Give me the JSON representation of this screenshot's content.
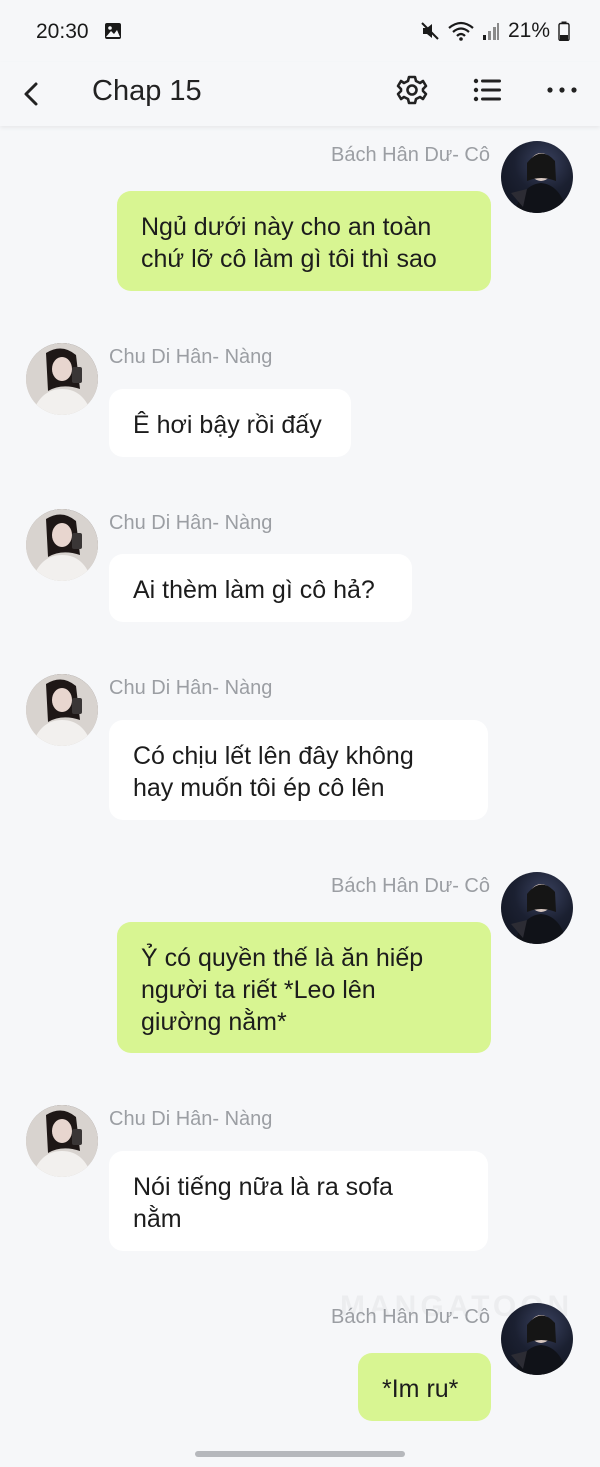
{
  "status_bar": {
    "time": "20:30",
    "battery": "21%",
    "icons": [
      "gallery-icon",
      "mute-icon",
      "wifi-icon",
      "signal-icon",
      "battery-icon"
    ]
  },
  "toolbar": {
    "title": "Chap 15",
    "icons": [
      "back-arrow-icon",
      "gear-icon",
      "list-icon",
      "more-dots-icon"
    ]
  },
  "messages": [
    {
      "side": "right",
      "name": "Bách Hân Dư- Cô",
      "text": "Ngủ dưới này cho an toàn\nchứ lỡ cô làm gì tôi thì sao"
    },
    {
      "side": "left",
      "name": "Chu Di Hân- Nàng",
      "text": "Ê hơi bậy rồi đấy"
    },
    {
      "side": "left",
      "name": "Chu Di Hân- Nàng",
      "text": "Ai thèm làm gì cô hả?"
    },
    {
      "side": "left",
      "name": "Chu Di Hân- Nàng",
      "text": "Có chịu lết lên đây không\nhay muốn tôi ép cô lên"
    },
    {
      "side": "right",
      "name": "Bách Hân Dư- Cô",
      "text": "Ỷ có quyền thế là ăn hiếp\nngười ta riết *Leo lên\ngiường nằm*"
    },
    {
      "side": "left",
      "name": "Chu Di Hân- Nàng",
      "text": "Nói tiếng nữa là ra sofa\nnằm"
    },
    {
      "side": "right",
      "name": "Bách Hân Dư- Cô",
      "text": "*Im ru*"
    }
  ],
  "watermark": "MANGATOON",
  "colors": {
    "background": "#f6f7f9",
    "right_bubble": "#d8f592",
    "left_bubble": "#ffffff",
    "name_text": "#9b9ea3"
  }
}
